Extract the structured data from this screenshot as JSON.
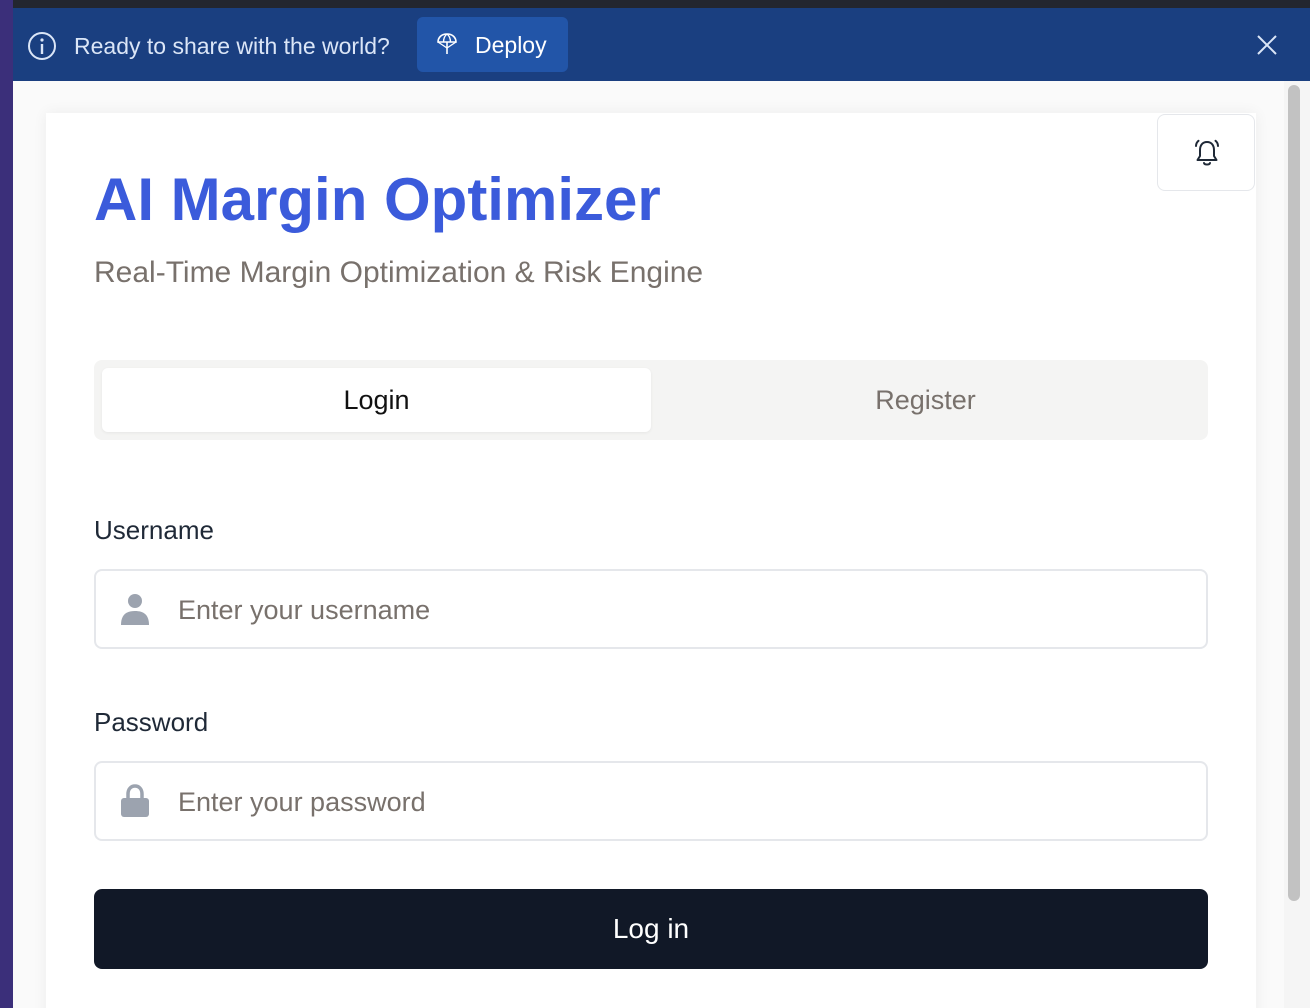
{
  "banner": {
    "message": "Ready to share with the world?",
    "deploy_label": "Deploy"
  },
  "app": {
    "title": "AI Margin Optimizer",
    "subtitle": "Real-Time Margin Optimization & Risk Engine"
  },
  "tabs": [
    {
      "label": "Login",
      "active": true
    },
    {
      "label": "Register",
      "active": false
    }
  ],
  "form": {
    "username_label": "Username",
    "username_placeholder": "Enter your username",
    "username_value": "",
    "password_label": "Password",
    "password_placeholder": "Enter your password",
    "password_value": "",
    "submit_label": "Log in"
  },
  "colors": {
    "banner_bg": "#1a3f80",
    "deploy_bg": "#2255a8",
    "title": "#3b5bdb",
    "primary_button": "#111827"
  },
  "icons": [
    "info-icon",
    "deploy-icon",
    "close-icon",
    "bell-icon",
    "user-icon",
    "lock-icon"
  ]
}
